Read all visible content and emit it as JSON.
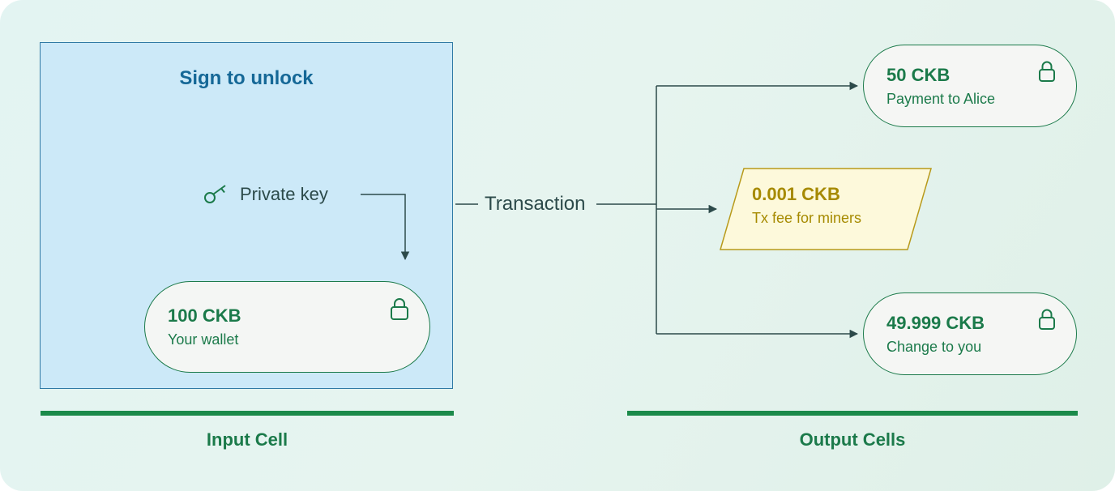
{
  "input_box": {
    "title": "Sign to unlock",
    "private_key_label": "Private key"
  },
  "wallet": {
    "amount": "100 CKB",
    "sub": "Your wallet"
  },
  "transaction": {
    "label": "Transaction"
  },
  "fee": {
    "amount": "0.001 CKB",
    "sub": "Tx fee for miners"
  },
  "output_a": {
    "amount": "50 CKB",
    "sub": "Payment to Alice"
  },
  "output_c": {
    "amount": "49.999 CKB",
    "sub": "Change to you"
  },
  "sections": {
    "input": "Input Cell",
    "output": "Output Cells"
  },
  "colors": {
    "green": "#1b7a4a",
    "blue": "#156897",
    "gold": "#a68a00",
    "slate": "#2c4a4a"
  }
}
